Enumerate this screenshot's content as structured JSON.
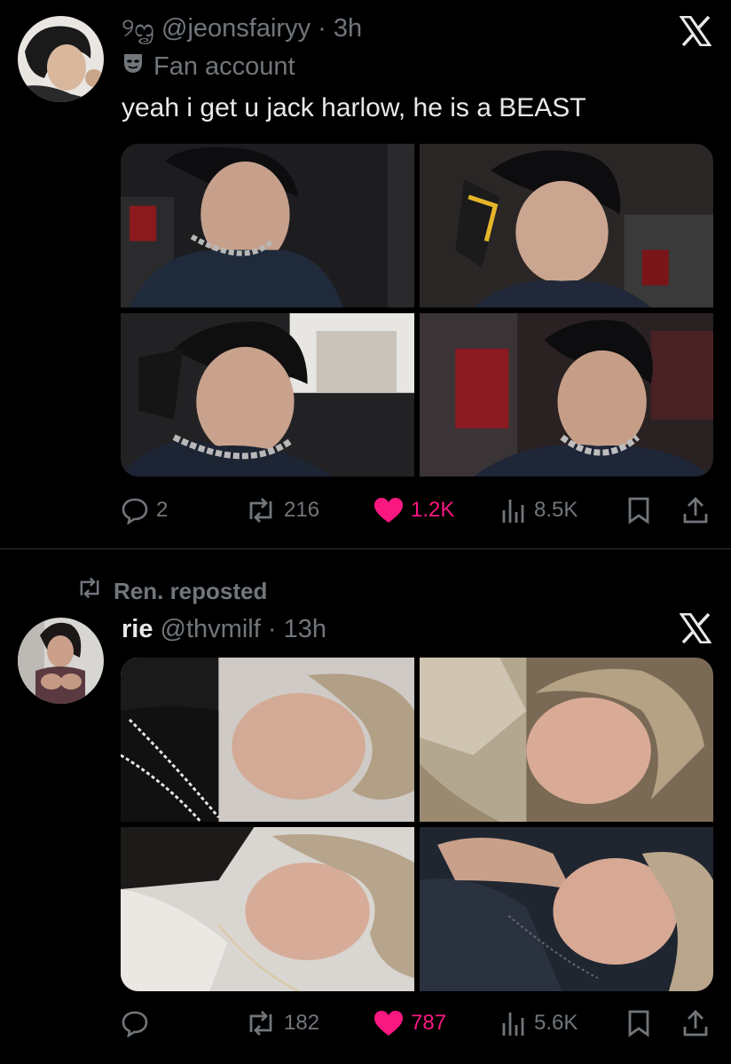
{
  "tweets": [
    {
      "author_prefix": "୨ᦗ",
      "handle": "@jeonsfairyy",
      "separator": "·",
      "time": "3h",
      "label_icon": "mask-icon",
      "label": "Fan account",
      "text": "yeah i get u jack harlow, he is a BEAST",
      "images": [
        "photo-1",
        "photo-2",
        "photo-3",
        "photo-4"
      ],
      "actions": {
        "replies": "2",
        "reposts": "216",
        "likes": "1.2K",
        "views": "8.5K",
        "liked": true
      }
    },
    {
      "repost_by": "Ren. reposted",
      "name": "rie",
      "handle": "@thvmilf",
      "separator": "·",
      "time": "13h",
      "images": [
        "photo-1",
        "photo-2",
        "photo-3",
        "photo-4"
      ],
      "actions": {
        "replies": "",
        "reposts": "182",
        "likes": "787",
        "views": "5.6K",
        "liked": true
      }
    }
  ],
  "colors": {
    "background": "#000000",
    "text_primary": "#e7e9ea",
    "text_secondary": "#71767b",
    "like": "#f91880",
    "divider": "#2f3336"
  }
}
